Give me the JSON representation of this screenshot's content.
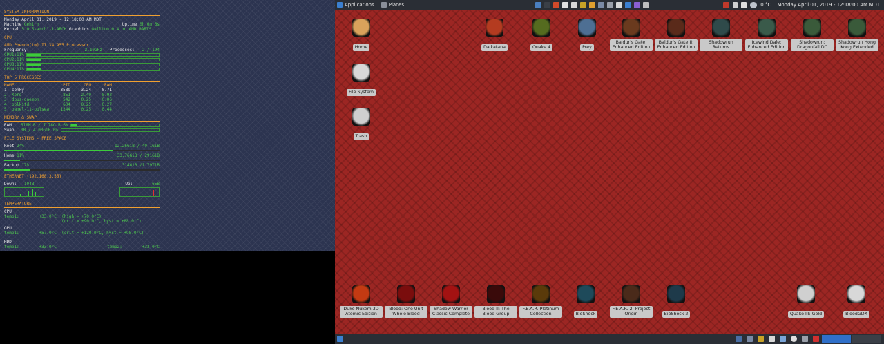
{
  "topbar": {
    "applications_label": "Applications",
    "places_label": "Places",
    "temperature": "0 °C",
    "clock": "Monday April 01, 2019 - 12:18:00 AM MDT",
    "icons": [
      "files-icon",
      "terminal-icon",
      "filezilla-icon",
      "text-editor-icon",
      "image-viewer-icon",
      "gimp-icon",
      "archive-icon",
      "folder-icon",
      "package-icon",
      "printer-icon",
      "bluetooth-icon",
      "mail-icon",
      "calculator-icon"
    ],
    "tray_icons": [
      "flag-icon",
      "pen-icon",
      "volume-icon",
      "weather-icon"
    ]
  },
  "conky": {
    "system": {
      "title": "SYSTEM INFORMATION",
      "date": "Monday April 01, 2019 - 12:18:00 AM MDT",
      "machine_label": "Machine",
      "machine": "Gehirn",
      "uptime_label": "Uptime",
      "uptime": "0h 6m 6s",
      "kernel_label": "Kernel",
      "kernel": "5.0.5-arch1-1-ARCH",
      "graphics_label": "Graphics",
      "graphics": "Gallium 0.4 on AMD BARTS"
    },
    "cpu": {
      "title": "CPU",
      "model": "AMD Phenom(tm) II X4 955 Processor",
      "frequency_label": "Frequency:",
      "frequency": "2.10GHz",
      "processes_label": "Processes:",
      "processes": "2 / 194",
      "cores": [
        {
          "label": "CPU1:",
          "value": "11%",
          "pct": 11
        },
        {
          "label": "CPU2:",
          "value": "11%",
          "pct": 11
        },
        {
          "label": "CPU3:",
          "value": "11%",
          "pct": 11
        },
        {
          "label": "CPU4:",
          "value": "11%",
          "pct": 11
        }
      ]
    },
    "processes": {
      "title": "TOP 5 PROCESSES",
      "headers": [
        "NAME",
        "PID",
        "CPU",
        "RAM"
      ],
      "rows": [
        [
          "1. conky",
          "3589",
          "3.24",
          "0.71"
        ],
        [
          "2. Xorg",
          "851",
          "2.49",
          "0.92"
        ],
        [
          "3. dbus-daemon",
          "542",
          "0.25",
          "0.06"
        ],
        [
          "4. polkitd",
          "604",
          "0.25",
          "0.27"
        ],
        [
          "5. panel-11-pulsea",
          "1344",
          "0.25",
          "0.44"
        ]
      ]
    },
    "memory": {
      "title": "MEMORY & SWAP",
      "ram_label": "RAM",
      "ram": "510MiB / 7.78GiB 6%",
      "ram_pct": 6,
      "swap_label": "Swap",
      "swap": "0B / 4.00GiB 0%",
      "swap_pct": 0
    },
    "filesystems": {
      "title": "FILE SYSTEMS - FREE SPACE",
      "items": [
        {
          "name": "Root",
          "pct_label": "24%",
          "space": "12.26GiB / 49.1GiB",
          "pct": 70
        },
        {
          "name": "Home",
          "pct_label": "11%",
          "space": "33.76GiB / 291GiB",
          "pct": 10
        },
        {
          "name": "Backup",
          "pct_label": "17%",
          "space": "314GiB /1.79TiB",
          "pct": 17
        }
      ]
    },
    "network": {
      "title": "ETHERNET (192.168.3.55)",
      "down_label": "Down:",
      "down": "104B",
      "up_label": "Up:",
      "up": "65B"
    },
    "temperature": {
      "title": "TEMPERATURE",
      "cpu_label": "CPU",
      "cpu_line1": "temp1:        +33.0°C  (high = +70.0°C)",
      "cpu_line2": "                       (crit = +90.0°C, hyst = +88.0°C)",
      "gpu_label": "GPU",
      "gpu_line1": "temp1:        +57.0°C  (crit = +120.0°C, hyst = +90.0°C)",
      "hdd_label": "HDD",
      "hdd_temp1": "temp1:        +33.0°C",
      "hdd_temp2": "temp2:        +32.0°C"
    }
  },
  "desktop": {
    "icons_top": [
      {
        "label": "Home",
        "color": "#d9a25b"
      },
      {
        "label": "Daikatana",
        "color": "#b43b20"
      },
      {
        "label": "Quake 4",
        "color": "#556b1f"
      },
      {
        "label": "Prey",
        "color": "#4e6f93"
      },
      {
        "label": "Baldur's Gate: Enhanced Edition",
        "color": "#6a3a1e"
      },
      {
        "label": "Baldur's Gate II: Enhanced Edition",
        "color": "#5a2a1a"
      },
      {
        "label": "Shadowrun Returns",
        "color": "#2f4a4a"
      },
      {
        "label": "Icewind Dale: Enhanced Edition",
        "color": "#3a5a4a"
      },
      {
        "label": "Shadowrun: Dragonfall DC",
        "color": "#3a5a3a"
      },
      {
        "label": "Shadowrun Hong Kong Extended",
        "color": "#3a5a3a"
      }
    ],
    "icons_left": [
      {
        "label": "File System",
        "color": "#d8d8d8"
      },
      {
        "label": "Trash",
        "color": "#cfcfcf"
      }
    ],
    "icons_bottom": [
      {
        "label": "Duke Nukem 3D Atomic Edition",
        "color": "#c33a12"
      },
      {
        "label": "Blood: One Unit Whole Blood",
        "color": "#7a0d0d"
      },
      {
        "label": "Shadow Warrior Classic Complete",
        "color": "#a31212"
      },
      {
        "label": "Blood II: The Blood Group",
        "color": "#3a0a0a"
      },
      {
        "label": "F.E.A.R. Platinum Collection",
        "color": "#5a3a0a"
      },
      {
        "label": "BioShock",
        "color": "#1e4a5a"
      },
      {
        "label": "F.E.A.R. 2: Project Origin",
        "color": "#4a2a1a"
      },
      {
        "label": "BioShock 2",
        "color": "#1e3a4a"
      },
      {
        "label": "Quake III: Gold",
        "color": "#d0d0d0"
      },
      {
        "label": "BloodGDX",
        "color": "#d8d8d8"
      }
    ]
  }
}
